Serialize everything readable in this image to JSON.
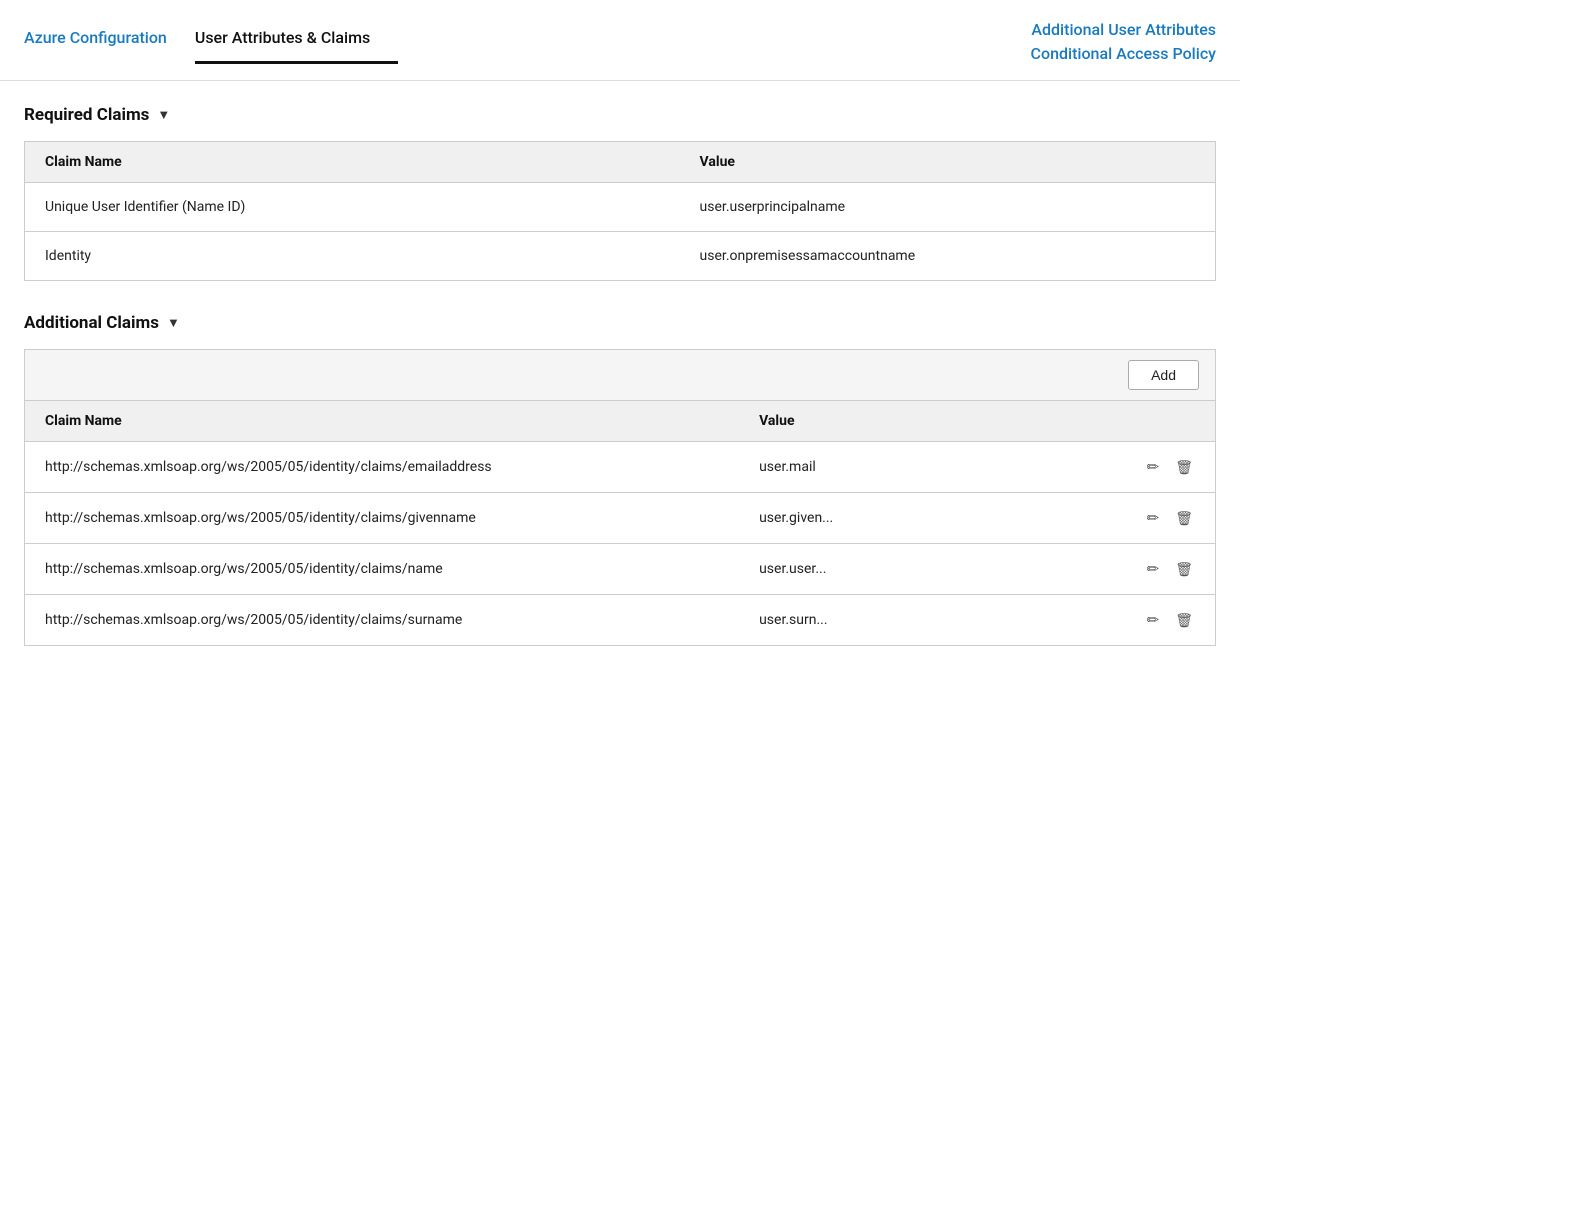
{
  "nav": {
    "items": [
      {
        "id": "azure-config",
        "label": "Azure Configuration",
        "active": false
      },
      {
        "id": "user-attributes-claims",
        "label": "User Attributes & Claims",
        "active": true
      }
    ],
    "right": {
      "line1": "Additional User Attributes",
      "line2": "Conditional Access Policy"
    }
  },
  "required_claims": {
    "heading": "Required Claims",
    "col_name": "Claim Name",
    "col_value": "Value",
    "rows": [
      {
        "name": "Unique User Identifier (Name ID)",
        "value": "user.userprincipalname"
      },
      {
        "name": "Identity",
        "value": "user.onpremisessamaccountname"
      }
    ]
  },
  "additional_claims": {
    "heading": "Additional Claims",
    "add_button": "Add",
    "col_name": "Claim Name",
    "col_value": "Value",
    "rows": [
      {
        "name": "http://schemas.xmlsoap.org/ws/2005/05/identity/claims/emailaddress",
        "value": "user.mail"
      },
      {
        "name": "http://schemas.xmlsoap.org/ws/2005/05/identity/claims/givenname",
        "value": "user.given..."
      },
      {
        "name": "http://schemas.xmlsoap.org/ws/2005/05/identity/claims/name",
        "value": "user.user..."
      },
      {
        "name": "http://schemas.xmlsoap.org/ws/2005/05/identity/claims/surname",
        "value": "user.surn..."
      }
    ]
  }
}
